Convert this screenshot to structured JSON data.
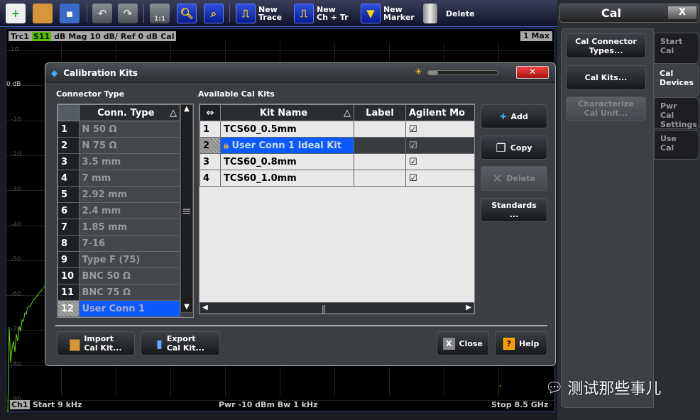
{
  "toolbar": {
    "new_trace": [
      "New",
      "Trace"
    ],
    "new_ch_tr": [
      "New",
      "Ch + Tr"
    ],
    "new_marker": [
      "New",
      "Marker"
    ],
    "delete": "Delete",
    "zoom_1_1": "1:1"
  },
  "trace": {
    "name": "Trc1",
    "param": "S11",
    "format": "dB Mag",
    "scale": "10 dB/",
    "ref": "Ref 0 dB",
    "cal": "Cal",
    "marker": "1 Max"
  },
  "y_axis_labels": [
    "10",
    "0 dB",
    "-10",
    "-20",
    "-30",
    "-40",
    "-50",
    "-60",
    "-70",
    "-80",
    "-90"
  ],
  "status": {
    "ch": "Ch1",
    "start": "Start 9 kHz",
    "pwr": "Pwr -10 dBm Bw 1 kHz",
    "stop": "Stop 8.5 GHz"
  },
  "dialog": {
    "title": "Calibration Kits",
    "connector_type_label": "Connector Type",
    "conn_header": "Conn. Type",
    "connectors": [
      "N 50 Ω",
      "N 75 Ω",
      "3.5 mm",
      "7 mm",
      "2.92 mm",
      "2.4 mm",
      "1.85 mm",
      "7-16",
      "Type F (75)",
      "BNC 50 Ω",
      "BNC 75 Ω",
      "User Conn 1"
    ],
    "selected_connector": "User Conn 1",
    "available_label": "Available Cal Kits",
    "kit_columns": [
      "Kit Name",
      "Label",
      "Agilent Mo"
    ],
    "kits": [
      {
        "n": "1",
        "name": "TCS60_0.5mm",
        "label": "",
        "agilent": true
      },
      {
        "n": "2",
        "name": "User Conn 1 Ideal Kit",
        "label": "",
        "agilent": true,
        "locked": true,
        "selected": true
      },
      {
        "n": "3",
        "name": "TCS60_0.8mm",
        "label": "",
        "agilent": true
      },
      {
        "n": "4",
        "name": "TCS60_1.0mm",
        "label": "",
        "agilent": true
      }
    ],
    "buttons": {
      "add": "Add",
      "copy": "Copy",
      "delete": "Delete",
      "standards": [
        "Standards",
        "..."
      ],
      "import": [
        "Import",
        "Cal Kit..."
      ],
      "export": [
        "Export",
        "Cal Kit..."
      ],
      "close": "Close",
      "help": "Help"
    }
  },
  "right_panel": {
    "title": "Cal",
    "close": "X",
    "buttons": [
      [
        "Cal Connector",
        "Types..."
      ],
      [
        "Cal Kits..."
      ],
      [
        "Characterize",
        "Cal Unit..."
      ]
    ],
    "tabs": [
      [
        "Start",
        "Cal"
      ],
      [
        "Cal",
        "Devices"
      ],
      [
        "Pwr Cal",
        "Settings"
      ],
      [
        "Use",
        "Cal"
      ]
    ],
    "active_tab": 1
  },
  "watermark": "测试那些事儿",
  "colors": {
    "trace": "#66dd00",
    "selection": "#0a5aff",
    "toolbar_blue": "#2040d0"
  }
}
